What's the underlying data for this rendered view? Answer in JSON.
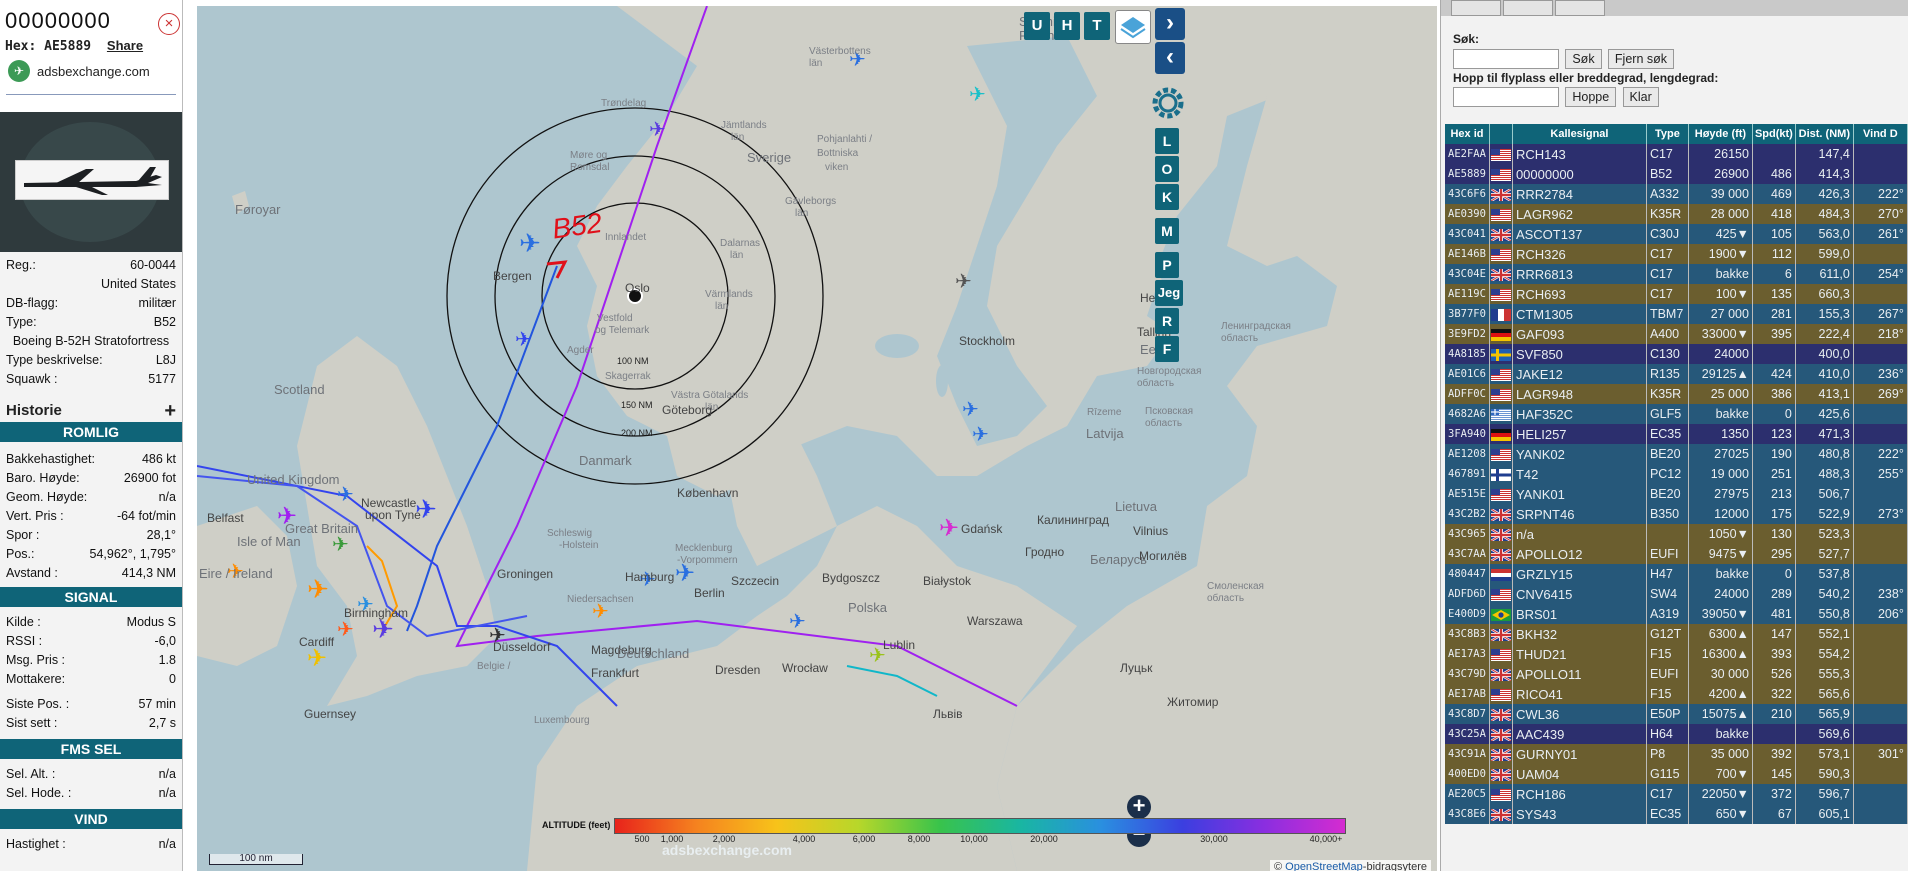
{
  "aircraft": {
    "callsign": "00000000",
    "hex_label": "Hex: AE5889",
    "share": "Share",
    "source_site": "adsbexchange.com",
    "reg_label": "Reg.:",
    "reg": "60-0044",
    "country": "United States",
    "db_flag_label": "DB-flagg:",
    "db_flag": "militær",
    "type_label": "Type:",
    "type": "B52",
    "full_type": "Boeing B-52H Stratofortress",
    "type_desc_label": "Type beskrivelse:",
    "type_desc": "L8J",
    "squawk_label": "Squawk :",
    "squawk": "5177",
    "history_label": "Historie",
    "history_plus": "+"
  },
  "sections": {
    "spatial": "ROMLIG",
    "signal": "SIGNAL",
    "fms": "FMS SEL",
    "wind": "VIND"
  },
  "spatial": [
    {
      "label": "Bakkehastighet:",
      "value": "486 kt"
    },
    {
      "label": "Baro. Høyde:",
      "value": "26900 fot"
    },
    {
      "label": "Geom. Høyde:",
      "value": "n/a"
    },
    {
      "label": "Vert. Pris :",
      "value": "-64 fot/min"
    },
    {
      "label": "Spor :",
      "value": "28,1°"
    },
    {
      "label": "Pos.:",
      "value": "54,962°, 1,795°"
    },
    {
      "label": "Avstand :",
      "value": "414,3 NM"
    }
  ],
  "signal": [
    {
      "label": "Kilde :",
      "value": "Modus S"
    },
    {
      "label": "RSSI :",
      "value": "-6,0"
    },
    {
      "label": "Msg. Pris :",
      "value": "1.8"
    },
    {
      "label": "Mottakere:",
      "value": "0"
    }
  ],
  "signal_times": [
    {
      "label": "Siste Pos. :",
      "value": "57 min"
    },
    {
      "label": "Sist sett :",
      "value": "2,7 s"
    }
  ],
  "fms": [
    {
      "label": "Sel. Alt. :",
      "value": "n/a"
    },
    {
      "label": "Sel. Hode. :",
      "value": "n/a"
    }
  ],
  "wind": [
    {
      "label": "Hastighet :",
      "value": "n/a"
    }
  ],
  "map": {
    "places": [
      {
        "name": "Suomi /",
        "cls": "big"
      },
      {
        "name": "Finland",
        "cls": "big"
      },
      {
        "name": "Västerbottens",
        "cls": "s"
      },
      {
        "name": "län",
        "cls": "s"
      },
      {
        "name": "Trøndelag",
        "cls": "s"
      },
      {
        "name": "Jämtlands",
        "cls": "s"
      },
      {
        "name": "län",
        "cls": "s"
      },
      {
        "name": "Sverige",
        "cls": "big"
      },
      {
        "name": "Pohjanlahti /",
        "cls": "s"
      },
      {
        "name": "Bottniska",
        "cls": "s"
      },
      {
        "name": "viken",
        "cls": "s"
      },
      {
        "name": "Møre og",
        "cls": "s"
      },
      {
        "name": "Romsdal",
        "cls": "s"
      },
      {
        "name": "Føroyar",
        "cls": "big"
      },
      {
        "name": "Innlandet",
        "cls": "s"
      },
      {
        "name": "Dalarnas",
        "cls": "s"
      },
      {
        "name": "län",
        "cls": "s"
      },
      {
        "name": "Gävleborgs",
        "cls": "s"
      },
      {
        "name": "län",
        "cls": "s"
      },
      {
        "name": "Bergen",
        "cls": "city"
      },
      {
        "name": "Oslo",
        "cls": "city"
      },
      {
        "name": "Värmlands",
        "cls": "s"
      },
      {
        "name": "län",
        "cls": "s"
      },
      {
        "name": "Vestfold",
        "cls": "s"
      },
      {
        "name": "og Telemark",
        "cls": "s"
      },
      {
        "name": "Agder",
        "cls": "s"
      },
      {
        "name": "Helsinki",
        "cls": "city"
      },
      {
        "name": "Tallinn",
        "cls": "city"
      },
      {
        "name": "Eesti",
        "cls": "big"
      },
      {
        "name": "Stockholm",
        "cls": "city"
      },
      {
        "name": "Skagerrak",
        "cls": "s"
      },
      {
        "name": "Västra Götalands",
        "cls": "s"
      },
      {
        "name": "län",
        "cls": "s"
      },
      {
        "name": "Göteborg",
        "cls": "city"
      },
      {
        "name": "Scotland",
        "cls": "big"
      },
      {
        "name": "Latvija",
        "cls": "big"
      },
      {
        "name": "Rīzeme",
        "cls": "s"
      },
      {
        "name": "United Kingdom",
        "cls": "big"
      },
      {
        "name": "Danmark",
        "cls": "big"
      },
      {
        "name": "Newcastle",
        "cls": "city"
      },
      {
        "name": "upon Tyne",
        "cls": "city"
      },
      {
        "name": "Belfast",
        "cls": "city"
      },
      {
        "name": "Great Britain",
        "cls": "big"
      },
      {
        "name": "Isle of Man",
        "cls": "big"
      },
      {
        "name": "København",
        "cls": "city"
      },
      {
        "name": "Lietuva",
        "cls": "big"
      },
      {
        "name": "Vilnius",
        "cls": "city"
      },
      {
        "name": "Калининград",
        "cls": "city"
      },
      {
        "name": "Gdańsk",
        "cls": "city"
      },
      {
        "name": "Гродно",
        "cls": "city"
      },
      {
        "name": "Беларусь",
        "cls": "big"
      },
      {
        "name": "Eire / Ireland",
        "cls": "big"
      },
      {
        "name": "Schleswig",
        "cls": "s"
      },
      {
        "name": "-Holstein",
        "cls": "s"
      },
      {
        "name": "Mecklenburg",
        "cls": "s"
      },
      {
        "name": "-Vorpommern",
        "cls": "s"
      },
      {
        "name": "Groningen",
        "cls": "city"
      },
      {
        "name": "Hamburg",
        "cls": "city"
      },
      {
        "name": "Szczecin",
        "cls": "city"
      },
      {
        "name": "Bydgoszcz",
        "cls": "city"
      },
      {
        "name": "Białystok",
        "cls": "city"
      },
      {
        "name": "Niedersachsen",
        "cls": "s"
      },
      {
        "name": "Berlin",
        "cls": "city"
      },
      {
        "name": "Polska",
        "cls": "big"
      },
      {
        "name": "Warszawa",
        "cls": "city"
      },
      {
        "name": "Cardiff",
        "cls": "city"
      },
      {
        "name": "Birmingham",
        "cls": "city"
      },
      {
        "name": "Düsseldorf",
        "cls": "city"
      },
      {
        "name": "Magdeburg",
        "cls": "city"
      },
      {
        "name": "Deutschland",
        "cls": "big"
      },
      {
        "name": "Lublin",
        "cls": "city"
      },
      {
        "name": "Belgie /",
        "cls": "s"
      },
      {
        "name": "Frankfurt",
        "cls": "city"
      },
      {
        "name": "Dresden",
        "cls": "city"
      },
      {
        "name": "Wrocław",
        "cls": "city"
      },
      {
        "name": "Guernsey",
        "cls": "city"
      },
      {
        "name": "Luxembourg",
        "cls": "s"
      },
      {
        "name": "Львів",
        "cls": "city"
      },
      {
        "name": "Луцьк",
        "cls": "city"
      },
      {
        "name": "Житомир",
        "cls": "city"
      },
      {
        "name": "Могилёв",
        "cls": "city"
      },
      {
        "name": "Новгородская",
        "cls": "s"
      },
      {
        "name": "область",
        "cls": "s"
      },
      {
        "name": "Псковская",
        "cls": "s"
      },
      {
        "name": "область",
        "cls": "s"
      },
      {
        "name": "Смоленская",
        "cls": "s"
      },
      {
        "name": "область",
        "cls": "s"
      },
      {
        "name": "Ленинградская",
        "cls": "s"
      },
      {
        "name": "область",
        "cls": "s"
      }
    ],
    "range_rings": [
      "100 NM",
      "150 NM",
      "200 NM"
    ],
    "annotation": "B52",
    "buttons": {
      "u": "U",
      "h": "H",
      "t": "T",
      "l": "L",
      "o": "O",
      "k": "K",
      "m": "M",
      "p": "P",
      "jeg": "Jeg",
      "r": "R",
      "f": "F"
    },
    "zoom_in": "+",
    "zoom_out": "−",
    "scale": "100 nm",
    "watermark": "adsbexchange.com",
    "attribution_prefix": "©",
    "attribution_link": "OpenStreetMap",
    "attribution_suffix": "-bidragsytere",
    "altitude_label": "ALTITUDE (feet)",
    "altitude_ticks": [
      "500",
      "1,000",
      "2,000",
      "4,000",
      "6,000",
      "8,000",
      "10,000",
      "20,000",
      "30,000",
      "40,000+"
    ]
  },
  "search": {
    "label": "Søk:",
    "search_btn": "Søk",
    "clear_btn": "Fjern søk",
    "jump_label": "Hopp til flyplass eller breddegrad, lengdegrad:",
    "jump_btn": "Hoppe",
    "ready_btn": "Klar"
  },
  "table": {
    "headers": [
      "Hex id",
      "",
      "Kallesignal",
      "Type",
      "Høyde (ft)",
      "Spd(kt)",
      "Dist. (NM)",
      "Vind D"
    ],
    "rows": [
      {
        "hex": "AE2FAA",
        "flag": "US",
        "cs": "RCH143",
        "type": "C17",
        "alt": "26150",
        "spd": "",
        "dist": "147,4",
        "wind": "",
        "bg": "#2c2f6e"
      },
      {
        "hex": "AE5889",
        "flag": "US",
        "cs": "00000000",
        "type": "B52",
        "alt": "26900",
        "spd": "486",
        "dist": "414,3",
        "wind": "",
        "bg": "#2c2f6e"
      },
      {
        "hex": "43C6F6",
        "flag": "GB",
        "cs": "RRR2784",
        "type": "A332",
        "alt": "39 000",
        "spd": "469",
        "dist": "426,3",
        "wind": "222°",
        "bg": "#26587a"
      },
      {
        "hex": "AE0390",
        "flag": "US",
        "cs": "LAGR962",
        "type": "K35R",
        "alt": "28 000",
        "spd": "418",
        "dist": "484,3",
        "wind": "270°",
        "bg": "#6b5e2f"
      },
      {
        "hex": "43C041",
        "flag": "GB",
        "cs": "ASCOT137",
        "type": "C30J",
        "alt": "425▼",
        "spd": "105",
        "dist": "563,0",
        "wind": "261°",
        "bg": "#26587a"
      },
      {
        "hex": "AE146B",
        "flag": "US",
        "cs": "RCH326",
        "type": "C17",
        "alt": "1900▼",
        "spd": "112",
        "dist": "599,0",
        "wind": "",
        "bg": "#6b5e2f"
      },
      {
        "hex": "43C04E",
        "flag": "GB",
        "cs": "RRR6813",
        "type": "C17",
        "alt": "bakke",
        "spd": "6",
        "dist": "611,0",
        "wind": "254°",
        "bg": "#26587a"
      },
      {
        "hex": "AE119C",
        "flag": "US",
        "cs": "RCH693",
        "type": "C17",
        "alt": "100▼",
        "spd": "135",
        "dist": "660,3",
        "wind": "",
        "bg": "#6b5e2f"
      },
      {
        "hex": "3B77F0",
        "flag": "FR",
        "cs": "CTM1305",
        "type": "TBM7",
        "alt": "27 000",
        "spd": "281",
        "dist": "155,3",
        "wind": "267°",
        "bg": "#26587a"
      },
      {
        "hex": "3E9FD2",
        "flag": "DE",
        "cs": "GAF093",
        "type": "A400",
        "alt": "33000▼",
        "spd": "395",
        "dist": "222,4",
        "wind": "218°",
        "bg": "#6b5e2f"
      },
      {
        "hex": "4A8185",
        "flag": "SE",
        "cs": "SVF850",
        "type": "C130",
        "alt": "24000",
        "spd": "",
        "dist": "400,0",
        "wind": "",
        "bg": "#2c2f6e"
      },
      {
        "hex": "AE01C6",
        "flag": "US",
        "cs": "JAKE12",
        "type": "R135",
        "alt": "29125▲",
        "spd": "424",
        "dist": "410,0",
        "wind": "236°",
        "bg": "#26587a"
      },
      {
        "hex": "ADFF0C",
        "flag": "US",
        "cs": "LAGR948",
        "type": "K35R",
        "alt": "25 000",
        "spd": "386",
        "dist": "413,1",
        "wind": "269°",
        "bg": "#6b5e2f"
      },
      {
        "hex": "4682A6",
        "flag": "GR",
        "cs": "HAF352C",
        "type": "GLF5",
        "alt": "bakke",
        "spd": "0",
        "dist": "425,6",
        "wind": "",
        "bg": "#26587a"
      },
      {
        "hex": "3FA940",
        "flag": "DE",
        "cs": "HELI257",
        "type": "EC35",
        "alt": "1350",
        "spd": "123",
        "dist": "471,3",
        "wind": "",
        "bg": "#2c2f6e"
      },
      {
        "hex": "AE1208",
        "flag": "US",
        "cs": "YANK02",
        "type": "BE20",
        "alt": "27025",
        "spd": "190",
        "dist": "480,8",
        "wind": "222°",
        "bg": "#26587a"
      },
      {
        "hex": "467891",
        "flag": "FI",
        "cs": "T42",
        "type": "PC12",
        "alt": "19 000",
        "spd": "251",
        "dist": "488,3",
        "wind": "255°",
        "bg": "#26587a"
      },
      {
        "hex": "AE515E",
        "flag": "US",
        "cs": "YANK01",
        "type": "BE20",
        "alt": "27975",
        "spd": "213",
        "dist": "506,7",
        "wind": "",
        "bg": "#26587a"
      },
      {
        "hex": "43C2B2",
        "flag": "GB",
        "cs": "SRPNT46",
        "type": "B350",
        "alt": "12000",
        "spd": "175",
        "dist": "522,9",
        "wind": "273°",
        "bg": "#26587a"
      },
      {
        "hex": "43C965",
        "flag": "GB",
        "cs": "n/a",
        "type": "",
        "alt": "1050▼",
        "spd": "130",
        "dist": "523,3",
        "wind": "",
        "bg": "#6b5e2f"
      },
      {
        "hex": "43C7AA",
        "flag": "GB",
        "cs": "APOLLO12",
        "type": "EUFI",
        "alt": "9475▼",
        "spd": "295",
        "dist": "527,7",
        "wind": "",
        "bg": "#6b5e2f"
      },
      {
        "hex": "480447",
        "flag": "NL",
        "cs": "GRZLY15",
        "type": "H47",
        "alt": "bakke",
        "spd": "0",
        "dist": "537,8",
        "wind": "",
        "bg": "#26587a"
      },
      {
        "hex": "ADFD6D",
        "flag": "US",
        "cs": "CNV6415",
        "type": "SW4",
        "alt": "24000",
        "spd": "289",
        "dist": "540,2",
        "wind": "238°",
        "bg": "#26587a"
      },
      {
        "hex": "E400D9",
        "flag": "BR",
        "cs": "BRS01",
        "type": "A319",
        "alt": "39050▼",
        "spd": "481",
        "dist": "550,8",
        "wind": "206°",
        "bg": "#26587a"
      },
      {
        "hex": "43C8B3",
        "flag": "GB",
        "cs": "BKH32",
        "type": "G12T",
        "alt": "6300▲",
        "spd": "147",
        "dist": "552,1",
        "wind": "",
        "bg": "#6b5e2f"
      },
      {
        "hex": "AE17A3",
        "flag": "US",
        "cs": "THUD21",
        "type": "F15",
        "alt": "16300▲",
        "spd": "393",
        "dist": "554,2",
        "wind": "",
        "bg": "#6b5e2f"
      },
      {
        "hex": "43C79D",
        "flag": "GB",
        "cs": "APOLLO11",
        "type": "EUFI",
        "alt": "30 000",
        "spd": "526",
        "dist": "555,3",
        "wind": "",
        "bg": "#6b5e2f"
      },
      {
        "hex": "AE17AB",
        "flag": "US",
        "cs": "RICO41",
        "type": "F15",
        "alt": "4200▲",
        "spd": "322",
        "dist": "565,6",
        "wind": "",
        "bg": "#6b5e2f"
      },
      {
        "hex": "43C8D7",
        "flag": "GB",
        "cs": "CWL36",
        "type": "E50P",
        "alt": "15075▲",
        "spd": "210",
        "dist": "565,9",
        "wind": "",
        "bg": "#26587a"
      },
      {
        "hex": "43C25A",
        "flag": "GB",
        "cs": "AAC439",
        "type": "H64",
        "alt": "bakke",
        "spd": "",
        "dist": "569,6",
        "wind": "",
        "bg": "#2c2f6e"
      },
      {
        "hex": "43C91A",
        "flag": "GB",
        "cs": "GURNY01",
        "type": "P8",
        "alt": "35 000",
        "spd": "392",
        "dist": "573,1",
        "wind": "301°",
        "bg": "#6b5e2f"
      },
      {
        "hex": "400ED0",
        "flag": "GB",
        "cs": "UAM04",
        "type": "G115",
        "alt": "700▼",
        "spd": "145",
        "dist": "590,3",
        "wind": "",
        "bg": "#6b5e2f"
      },
      {
        "hex": "AE20C5",
        "flag": "US",
        "cs": "RCH186",
        "type": "C17",
        "alt": "22050▼",
        "spd": "372",
        "dist": "596,7",
        "wind": "",
        "bg": "#26587a"
      },
      {
        "hex": "43C8E6",
        "flag": "GB",
        "cs": "SYS43",
        "type": "EC35",
        "alt": "650▼",
        "spd": "67",
        "dist": "605,1",
        "wind": "",
        "bg": "#26587a"
      }
    ]
  }
}
